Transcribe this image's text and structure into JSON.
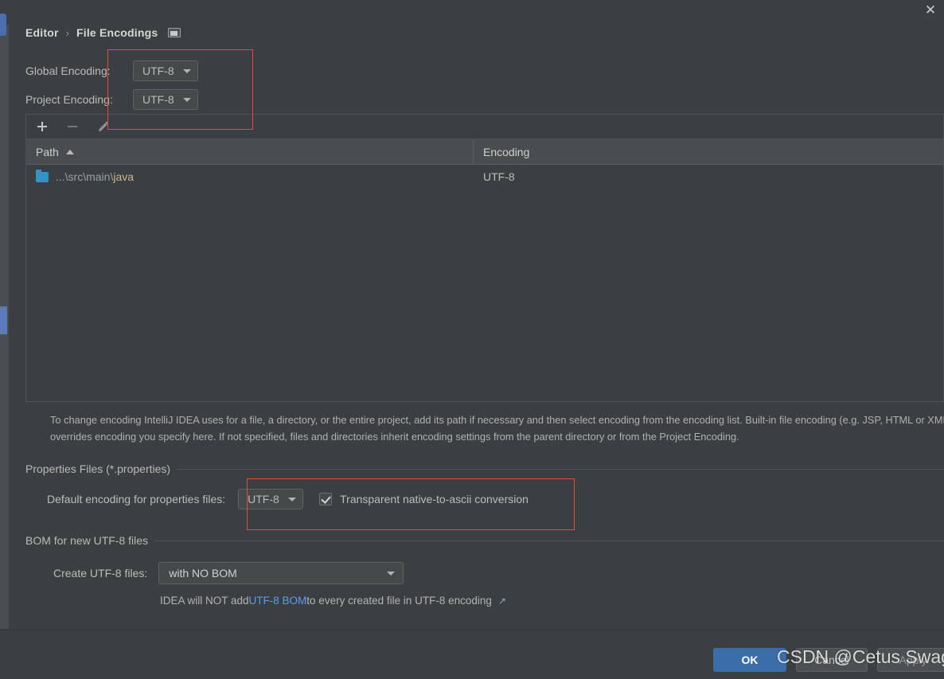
{
  "window": {
    "close_label": "✕"
  },
  "breadcrumb": {
    "root": "Editor",
    "separator": "›",
    "current": "File Encodings"
  },
  "encodings": {
    "global": {
      "label": "Global Encoding:",
      "value": "UTF-8"
    },
    "project": {
      "label": "Project Encoding:",
      "value": "UTF-8"
    }
  },
  "toolbar": {
    "add_label": "+",
    "remove_label": "−",
    "edit_label": "✎"
  },
  "table": {
    "columns": [
      "Path",
      "Encoding"
    ],
    "sort_column": "Path",
    "sort_direction": "asc",
    "rows": [
      {
        "path_prefix": "...\\src\\main\\",
        "path_leaf": "java",
        "encoding": "UTF-8"
      }
    ]
  },
  "hint": "To change encoding IntelliJ IDEA uses for a file, a directory, or the entire project, add its path if necessary and then select encoding from the encoding list. Built-in file encoding (e.g. JSP, HTML or XML) overrides encoding you specify here. If not specified, files and directories inherit encoding settings from the parent directory or from the Project Encoding.",
  "properties_group": {
    "title": "Properties Files (*.properties)",
    "default_encoding_label": "Default encoding for properties files:",
    "default_encoding_value": "UTF-8",
    "ascii_checkbox_label": "Transparent native-to-ascii conversion",
    "ascii_checkbox_checked": true
  },
  "bom_group": {
    "title": "BOM for new UTF-8 files",
    "create_label": "Create UTF-8 files:",
    "create_value": "with NO BOM",
    "note_before": "IDEA will NOT add ",
    "note_link": "UTF-8 BOM",
    "note_after": " to every created file in UTF-8 encoding",
    "external_link_icon": "↗"
  },
  "buttons": {
    "ok": "OK",
    "cancel": "Cancel",
    "apply": "Apply"
  },
  "watermark": "CSDN @Cetus SwaggyP",
  "colors": {
    "background": "#3c3f41",
    "accent_blue": "#3b6ea8",
    "link_blue": "#589df6",
    "folder_blue": "#3592c4",
    "annotation_red": "#f0433f",
    "scrollbar_blue": "#5b7bbd"
  }
}
